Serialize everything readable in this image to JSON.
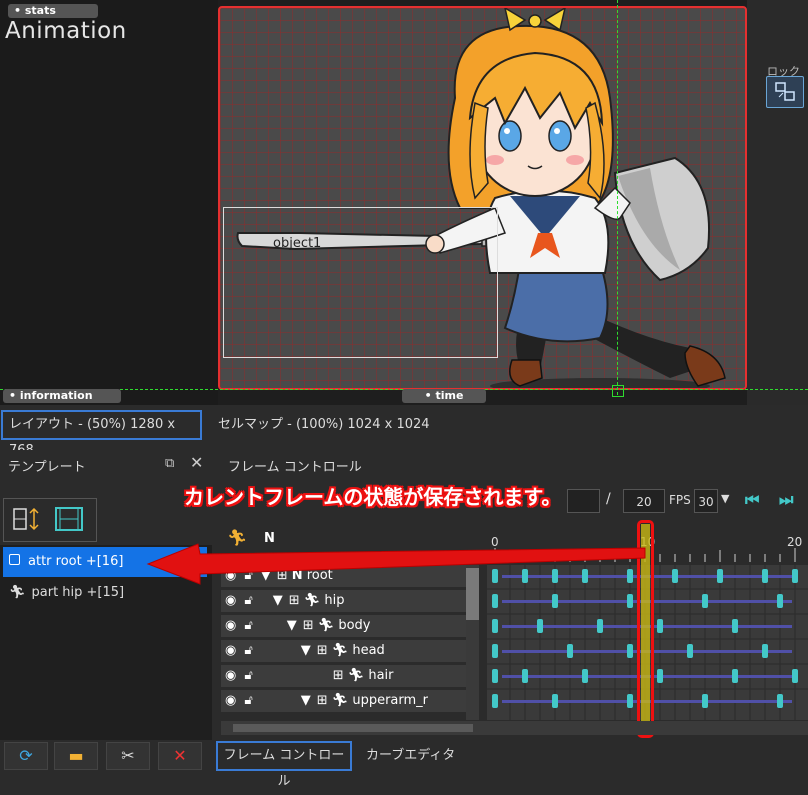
{
  "viewport": {
    "stats_tab": "• stats",
    "title": "Animation",
    "info_tab": "• information",
    "time_tab": "• time",
    "lock_label": "ロック",
    "object_label": "object1"
  },
  "statusbar": {
    "layout": "レイアウト - (50%) 1280 x 768",
    "cellmap": "セルマップ - (100%) 1024 x 1024"
  },
  "template_panel": {
    "title": "テンプレート",
    "items": [
      {
        "label": "attr root +[16]",
        "selected": true
      },
      {
        "label": "part hip +[15]",
        "selected": false
      }
    ]
  },
  "frame_control": {
    "title": "フレーム コントロール",
    "callout": "カレントフレームの状態が保存されます。",
    "slash": "/",
    "end_frame": "20",
    "fps_label": "FPS",
    "fps_value": "30",
    "ruler": [
      "0",
      "10",
      "20"
    ],
    "tree": [
      "root",
      "hip",
      "body",
      "head",
      "hair",
      "upperarm_r"
    ]
  },
  "bottom_tabs": [
    "フレーム コントロール",
    "カーブエディタ"
  ],
  "colors": {
    "accent": "#3a7bd5",
    "selection": "#1473e6",
    "highlight": "#e11111",
    "key": "#43c8c8"
  }
}
